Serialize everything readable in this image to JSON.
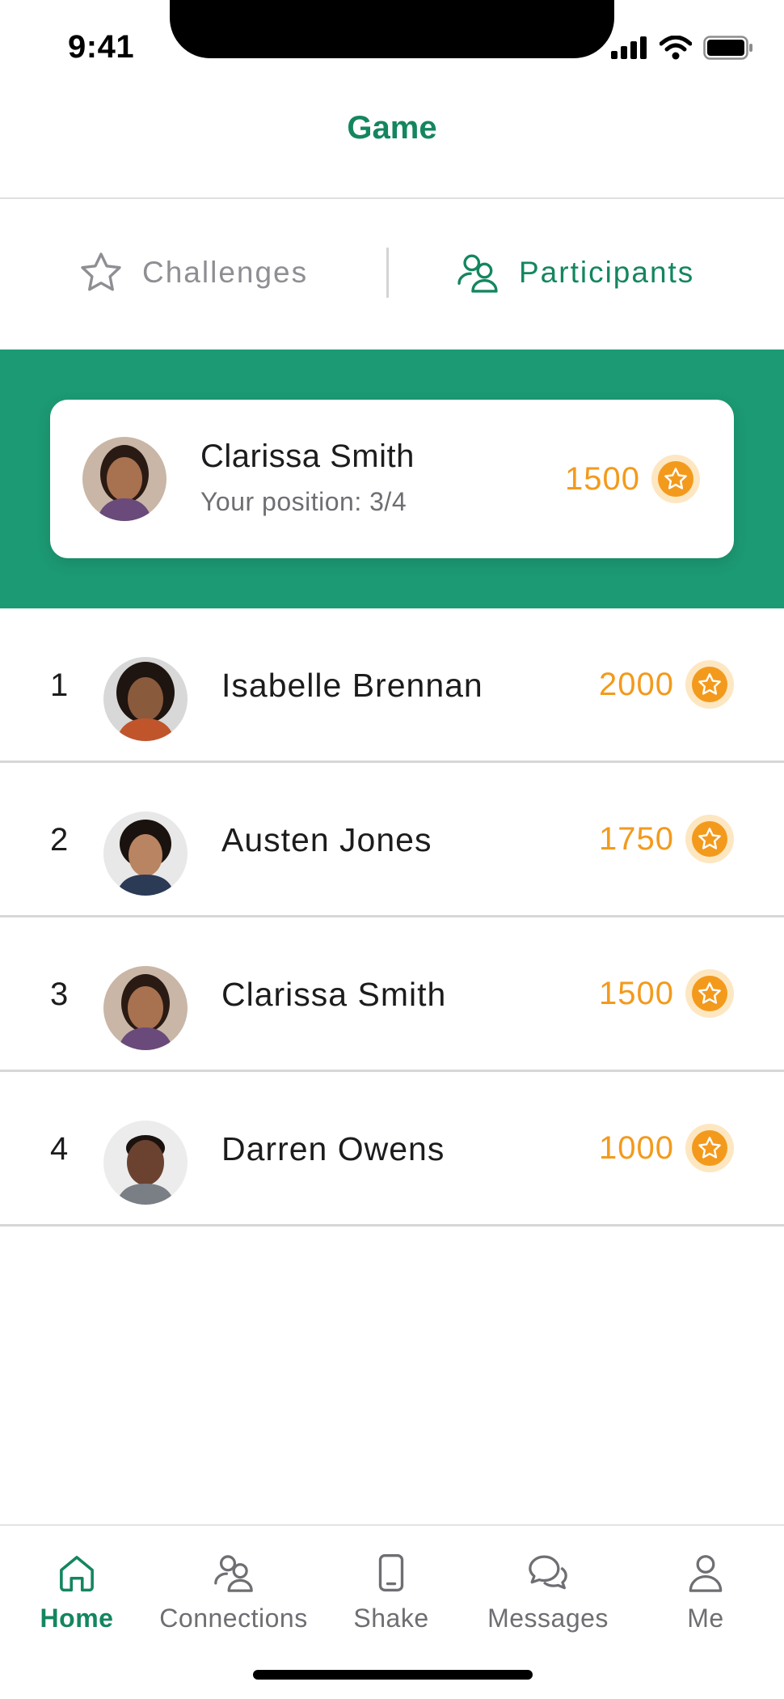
{
  "status_bar": {
    "time": "9:41"
  },
  "header": {
    "title": "Game"
  },
  "tabs": [
    {
      "label": "Challenges",
      "icon": "star-outline-icon",
      "active": false
    },
    {
      "label": "Participants",
      "icon": "people-icon",
      "active": true
    }
  ],
  "current_user": {
    "name": "Clarissa Smith",
    "position_text": "Your position: 3/4",
    "score": "1500"
  },
  "participants": [
    {
      "rank": "1",
      "name": "Isabelle Brennan",
      "score": "2000"
    },
    {
      "rank": "2",
      "name": "Austen Jones",
      "score": "1750"
    },
    {
      "rank": "3",
      "name": "Clarissa Smith",
      "score": "1500"
    },
    {
      "rank": "4",
      "name": "Darren Owens",
      "score": "1000"
    }
  ],
  "bottom_nav": [
    {
      "label": "Home",
      "icon": "home-icon",
      "active": true
    },
    {
      "label": "Connections",
      "icon": "people-icon",
      "active": false
    },
    {
      "label": "Shake",
      "icon": "phone-icon",
      "active": false
    },
    {
      "label": "Messages",
      "icon": "chat-bubbles-icon",
      "active": false
    },
    {
      "label": "Me",
      "icon": "person-icon",
      "active": false
    }
  ],
  "colors": {
    "brand_green": "#14865f",
    "hero_green": "#1c9a73",
    "score_orange": "#f39a1c"
  }
}
